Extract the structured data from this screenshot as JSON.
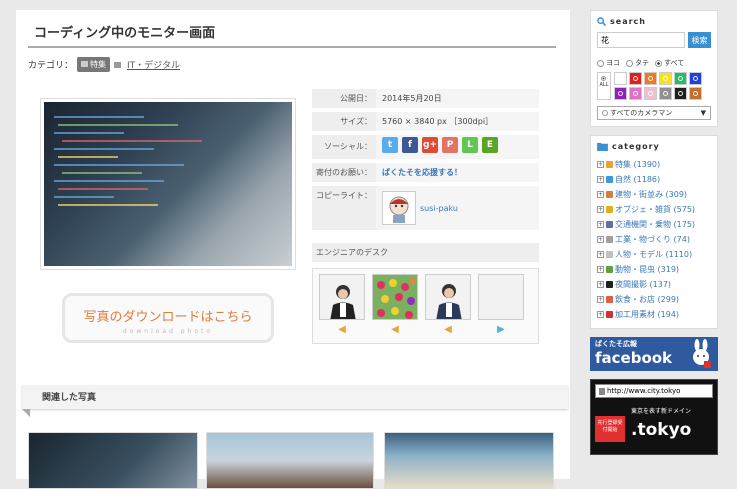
{
  "page": {
    "title": "コーディング中のモニター画面",
    "category_label": "カテゴリ：",
    "tag": "特集",
    "category_link": "IT・デジタル"
  },
  "download": {
    "main": "写真のダウンロードはこちら",
    "sub": "download photo"
  },
  "info": {
    "published_label": "公開日：",
    "published_value": "2014年5月20日",
    "size_label": "サイズ：",
    "size_value": "5760 × 3840 px ［300dpi］",
    "social_label": "ソーシャル：",
    "donate_label": "寄付のお願い：",
    "donate_value": "ぱくたそを応援する！",
    "copyright_label": "コピーライト：",
    "copyright_value": "susi-paku",
    "engineer_label": "エンジニアのデスク"
  },
  "social_icons": [
    {
      "name": "twitter-icon",
      "glyph": "t",
      "color": "#55acee"
    },
    {
      "name": "facebook-icon",
      "glyph": "f",
      "color": "#3b5998"
    },
    {
      "name": "googleplus-icon",
      "glyph": "g+",
      "color": "#dd4b39"
    },
    {
      "name": "pinterest-icon",
      "glyph": "P",
      "color": "#e57361"
    },
    {
      "name": "line-icon",
      "glyph": "L",
      "color": "#62c654"
    },
    {
      "name": "evernote-icon",
      "glyph": "E",
      "color": "#5ba525"
    }
  ],
  "section": {
    "related": "関連した写真"
  },
  "sidebar": {
    "search_title": "search",
    "search_value": "花",
    "search_button": "検索",
    "orient_yoko": "ヨコ",
    "orient_tate": "タテ",
    "orient_all": "すべて",
    "all_colors": "ALL",
    "camera_select": "すべてのカメラマン",
    "category_title": "category",
    "categories": [
      {
        "label": "特集 (1390)",
        "color": "#f0a030"
      },
      {
        "label": "自然 (1186)",
        "color": "#3a9ad9"
      },
      {
        "label": "建物・街並み (309)",
        "color": "#d08040"
      },
      {
        "label": "オブジェ・雑貨 (575)",
        "color": "#e0b020"
      },
      {
        "label": "交通機関・乗物 (175)",
        "color": "#6070a0"
      },
      {
        "label": "工業・物づくり (74)",
        "color": "#a0a0a0"
      },
      {
        "label": "人物・モデル (1110)",
        "color": "#c0c0c0"
      },
      {
        "label": "動物・昆虫 (319)",
        "color": "#60a040"
      },
      {
        "label": "夜間撮影 (137)",
        "color": "#202020"
      },
      {
        "label": "飲食・お店 (299)",
        "color": "#e06040"
      },
      {
        "label": "加工用素材 (194)",
        "color": "#d03030"
      }
    ],
    "banner1_top": "ぱくたそ広報",
    "banner1_main": "facebook",
    "banner2_url": "http://www.city.tokyo",
    "banner2_text": "東京を表す新ドメイン",
    "banner2_badge": "先行登録受付開始",
    "banner2_domain": ".tokyo"
  },
  "swatches": [
    "#ffffff",
    "#e02020",
    "#f07820",
    "#f8e020",
    "#20c060",
    "#2040e0",
    "#9020c0",
    "#e070c0",
    "#f0c0d0",
    "#909090",
    "#202020",
    "#c07030"
  ]
}
